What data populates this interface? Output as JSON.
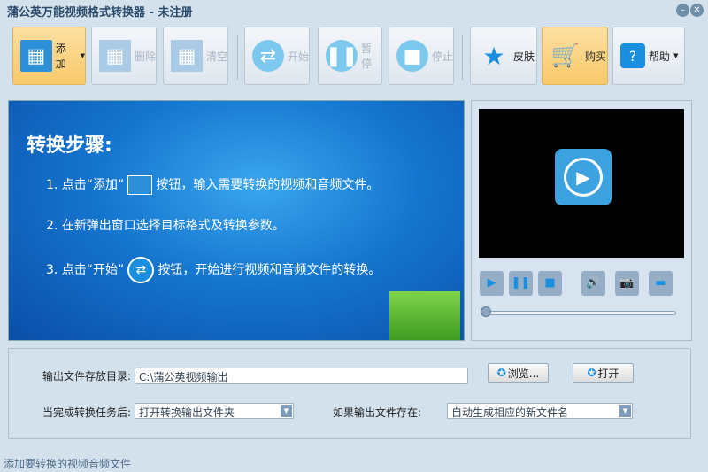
{
  "window": {
    "title": "蒲公英万能视频格式转换器 - 未注册",
    "minimize_icon": "minimize-icon",
    "close_icon": "close-icon"
  },
  "toolbar": {
    "add": "添加",
    "delete": "删除",
    "clear": "清空",
    "start": "开始",
    "pause": "暂停",
    "stop": "停止",
    "skin": "皮肤",
    "buy": "购买",
    "help": "帮助"
  },
  "banner": {
    "title": "转换步骤:",
    "step1a": "1. 点击“添加”",
    "step1b": "按钮，输入需要转换的视频和音频文件。",
    "step2": "2. 在新弹出窗口选择目标格式及转换参数。",
    "step3a": "3. 点击“开始”",
    "step3b": "按钮，开始进行视频和音频文件的转换。"
  },
  "player": {
    "seek_progress": 0
  },
  "settings": {
    "output_dir_label": "输出文件存放目录:",
    "output_dir_value": "C:\\蒲公英视频输出",
    "browse": "浏览...",
    "open": "打开",
    "after_label": "当完成转换任务后:",
    "after_value": "打开转换输出文件夹",
    "exists_label": "如果输出文件存在:",
    "exists_value": "自动生成相应的新文件名"
  },
  "status": "添加要转换的视频音频文件",
  "colors": {
    "accent": "#1a8fe0",
    "highlight": "#f8c96a",
    "banner": "#1576cf"
  }
}
